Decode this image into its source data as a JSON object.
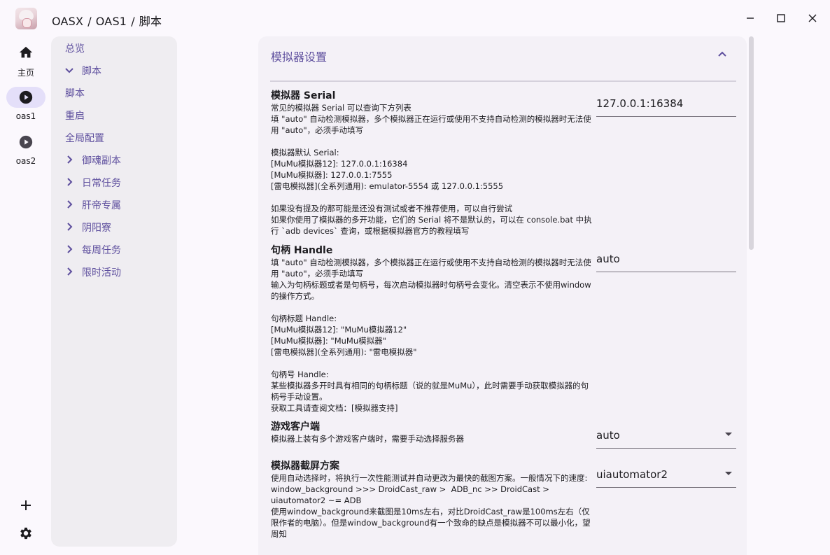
{
  "breadcrumb": [
    "OASX",
    "/",
    "OAS1",
    "/",
    "脚本"
  ],
  "window_controls": {
    "minimize": "minimize-icon",
    "maximize": "maximize-icon",
    "close": "close-icon"
  },
  "nav": {
    "items": [
      {
        "label": "主页",
        "icon": "home-icon"
      },
      {
        "label": "oas1",
        "icon": "play-circle-icon",
        "active": true
      },
      {
        "label": "oas2",
        "icon": "play-circle-icon"
      }
    ],
    "bottom": [
      "add-icon",
      "gear-icon"
    ]
  },
  "tree": [
    {
      "label": "总览",
      "indent": false,
      "chevron": ""
    },
    {
      "label": "脚本",
      "indent": true,
      "chevron": "down"
    },
    {
      "label": "脚本",
      "indent": false,
      "chevron": ""
    },
    {
      "label": "重启",
      "indent": false,
      "chevron": ""
    },
    {
      "label": "全局配置",
      "indent": false,
      "chevron": ""
    },
    {
      "label": "御魂副本",
      "indent": true,
      "chevron": "right"
    },
    {
      "label": "日常任务",
      "indent": true,
      "chevron": "right"
    },
    {
      "label": "肝帝专属",
      "indent": true,
      "chevron": "right"
    },
    {
      "label": "阴阳寮",
      "indent": true,
      "chevron": "right"
    },
    {
      "label": "每周任务",
      "indent": true,
      "chevron": "right"
    },
    {
      "label": "限时活动",
      "indent": true,
      "chevron": "right"
    }
  ],
  "section": {
    "title": "模拟器设置",
    "options": [
      {
        "title": "模拟器 Serial",
        "desc": "常见的模拟器 Serial 可以查询下方列表\n填 \"auto\" 自动检测模拟器，多个模拟器正在运行或使用不支持自动检测的模拟器时无法使用 \"auto\"，必须手动填写\n\n模拟器默认 Serial:\n[MuMu模拟器12]: 127.0.0.1:16384\n[MuMu模拟器]: 127.0.0.1:7555\n[雷电模拟器](全系列通用): emulator-5554 或 127.0.0.1:5555\n\n如果没有提及的那可能是还没有测试或者不推荐使用，可以自行尝试\n如果你使用了模拟器的多开功能，它们的 Serial 将不是默认的，可以在 console.bat 中执行 `adb devices` 查询，或根据模拟器官方的教程填写",
        "value": "127.0.0.1:16384",
        "dropdown": false
      },
      {
        "title": "句柄 Handle",
        "desc": "填 \"auto\" 自动检测模拟器，多个模拟器正在运行或使用不支持自动检测的模拟器时无法使用 \"auto\"，必须手动填写\n输入为句柄标题或者是句柄号，每次启动模拟器时句柄号会变化。清空表示不使用window的操作方式。\n\n句柄标题 Handle:\n[MuMu模拟器12]: \"MuMu模拟器12\"\n[MuMu模拟器]: \"MuMu模拟器\"\n[雷电模拟器](全系列通用): \"雷电模拟器\"\n\n句柄号 Handle:\n某些模拟器多开时具有相同的句柄标题（说的就是MuMu），此时需要手动获取模拟器的句柄号手动设置。\n获取工具请查阅文档：[模拟器支持]",
        "value": "auto",
        "dropdown": false
      },
      {
        "title": "游戏客户端",
        "desc": "模拟器上装有多个游戏客户端时，需要手动选择服务器",
        "value": "auto",
        "dropdown": true
      },
      {
        "title": "模拟器截屏方案",
        "desc": "使用自动选择时，将执行一次性能测试并自动更改为最快的截图方案。一般情况下的速度:\nwindow_background >>> DroidCast_raw >  ADB_nc >> DroidCast > uiautomator2 ~= ADB\n使用window_background来截图是10ms左右，对比DroidCast_raw是100ms左右（仅限作者的电脑）。但是window_background有一个致命的缺点是模拟器不可以最小化，望周知",
        "value": "uiautomator2",
        "dropdown": true
      }
    ]
  },
  "colors": {
    "accent": "#5e4f9e",
    "nav_active": "#e4dff9",
    "tree_bg": "#efedf1",
    "panel_bg": "#f4f1f7"
  }
}
